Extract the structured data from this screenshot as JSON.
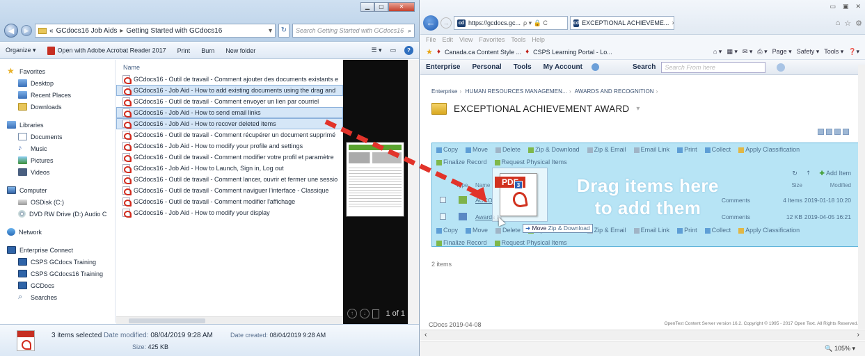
{
  "explorer": {
    "address": {
      "prefix": "«",
      "crumbs": [
        "GCdocs16 Job Aids",
        "Getting Started with GCdocs16"
      ]
    },
    "search_placeholder": "Search Getting Started with GCdocs16",
    "toolbar": {
      "organize": "Organize ▾",
      "open_with": "Open with Adobe Acrobat Reader 2017",
      "print": "Print",
      "burn": "Burn",
      "new_folder": "New folder"
    },
    "nav": {
      "favorites": "Favorites",
      "desktop": "Desktop",
      "recent_places": "Recent Places",
      "downloads": "Downloads",
      "libraries": "Libraries",
      "documents": "Documents",
      "music": "Music",
      "pictures": "Pictures",
      "videos": "Videos",
      "computer": "Computer",
      "osdisk": "OSDisk (C:)",
      "dvd": "DVD RW Drive (D:) Audio C",
      "network": "Network",
      "enterprise_connect": "Enterprise Connect",
      "csps_training": "CSPS GCdocs Training",
      "csps16_training": "CSPS GCdocs16 Training",
      "gcdocs": "GCDocs",
      "searches": "Searches"
    },
    "column_name": "Name",
    "files": [
      {
        "name": "GCdocs16 - Outil de travail - Comment ajouter des documents existants e",
        "selected": false
      },
      {
        "name": "GCdocs16 - Job Aid - How to add existing documents using the drag and",
        "selected": true
      },
      {
        "name": "GCdocs16 - Outil de travail - Comment envoyer un lien par courriel",
        "selected": false
      },
      {
        "name": "GCdocs16 - Job Aid - How to send email links",
        "selected": true
      },
      {
        "name": "GCdocs16 - Job Aid - How to recover deleted items",
        "selected": true
      },
      {
        "name": "GCdocs16 - Outil de travail - Comment récupérer un document supprimé",
        "selected": false
      },
      {
        "name": "GCdocs16 - Job Aid - How to modify your profile and settings",
        "selected": false
      },
      {
        "name": "GCdocs16 - Outil de travail - Comment modifier votre profil et paramètre",
        "selected": false
      },
      {
        "name": "GCdocs16 - Job Aid - How to Launch, Sign in, Log out",
        "selected": false
      },
      {
        "name": "GCdocs16 - Outil de travail - Comment lancer, ouvrir et fermer une sessio",
        "selected": false
      },
      {
        "name": "GCdocs16 - Outil de travail - Comment naviguer l'interface - Classique",
        "selected": false
      },
      {
        "name": "GCdocs16 - Outil de travail - Comment modifier l'affichage",
        "selected": false
      },
      {
        "name": "GCdocs16 - Job Aid - How to modify your display",
        "selected": false
      }
    ],
    "preview_page": "1 of 1",
    "details": {
      "selected": "3 items selected",
      "modified_label": "Date modified:",
      "modified": "08/04/2019 9:28 AM",
      "created_label": "Date created:",
      "created": "08/04/2019 9:28 AM",
      "size_label": "Size:",
      "size": "425 KB"
    }
  },
  "browser": {
    "url": "https://gcdocs.gc...",
    "url_icons": "ρ ▾ 🔒 C",
    "tab_title": "EXCEPTIONAL ACHIEVEME...",
    "menu": [
      "File",
      "Edit",
      "View",
      "Favorites",
      "Tools",
      "Help"
    ],
    "favorites": [
      "Canada.ca Content Style ...",
      "CSPS Learning Portal - Lo..."
    ],
    "commands": [
      "Page ▾",
      "Safety ▾",
      "Tools ▾"
    ],
    "cs_nav": [
      "Enterprise",
      "Personal",
      "Tools",
      "My Account"
    ],
    "search_label": "Search",
    "search_placeholder": "Search From here",
    "breadcrumb": [
      "Enterprise",
      "HUMAN RESOURCES MANAGEMEN...",
      "AWARDS AND RECOGNITION"
    ],
    "page_title": "EXCEPTIONAL ACHIEVEMENT AWARD",
    "actions": [
      "Copy",
      "Move",
      "Delete",
      "Zip & Download",
      "Zip & Email",
      "Email Link",
      "Print",
      "Collect",
      "Apply Classification"
    ],
    "actions_row2": [
      "Finalize Record",
      "Request Physical Items"
    ],
    "add_item": "Add Item",
    "columns": {
      "type": "Type",
      "name": "Name",
      "size": "Size",
      "modified": "Modified"
    },
    "rows": [
      {
        "name": "ACCO",
        "comment": "Comments",
        "size": "4 Items",
        "modified": "2019-01-18 10:20"
      },
      {
        "name": "Awards lis",
        "comment": "Comments",
        "size": "12 KB",
        "modified": "2019-04-05 16:21"
      }
    ],
    "drag_text_1": "Drag items here",
    "drag_text_2": "to add them",
    "items_count": "2 items",
    "footer_left": "CDocs  2019-04-08",
    "footer_right": "OpenText Content Server version 16.2. Copyright © 1995 - 2017 Open Text. All Rights Reserved.",
    "zoom": "105%"
  },
  "drag": {
    "badge": "3",
    "ghost_label": "PDF",
    "tooltip_action": "Move",
    "tooltip_rest": "Zip & Download"
  },
  "colors": {
    "dropzone": "#b7e4f5",
    "arrow": "#e2332a",
    "selection": "#d5e6f7"
  }
}
